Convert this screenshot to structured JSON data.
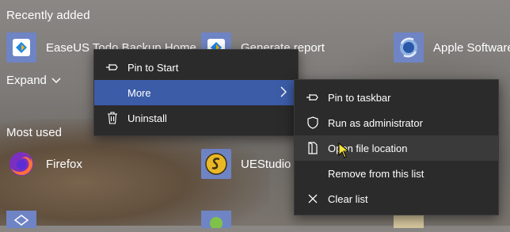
{
  "sections": {
    "recently_added": "Recently added",
    "expand": "Expand",
    "most_used": "Most used"
  },
  "recent_apps": [
    {
      "label": "EaseUS Todo Backup Home",
      "icon": "easeus-icon"
    },
    {
      "label": "Generate report",
      "icon": "report-icon"
    },
    {
      "label": "Apple Software",
      "icon": "apple-software-icon"
    }
  ],
  "most_used_apps": [
    {
      "label": "Firefox",
      "icon": "firefox-icon"
    },
    {
      "label": "UEStudio",
      "icon": "uestudio-icon"
    }
  ],
  "context_menu": {
    "items": [
      {
        "label": "Pin to Start",
        "icon": "pin-icon"
      },
      {
        "label": "More",
        "icon": "",
        "active": true
      },
      {
        "label": "Uninstall",
        "icon": "trash-icon"
      }
    ]
  },
  "submenu": {
    "items": [
      {
        "label": "Pin to taskbar",
        "icon": "pin-icon"
      },
      {
        "label": "Run as administrator",
        "icon": "shield-icon"
      },
      {
        "label": "Open file location",
        "icon": "folder-icon",
        "hover": true
      },
      {
        "label": "Remove from this list",
        "icon": ""
      },
      {
        "label": "Clear list",
        "icon": "close-icon"
      }
    ]
  },
  "colors": {
    "menu_bg": "#2b2b2b",
    "active": "#3c5ca8",
    "hover": "#3a3a3a",
    "tile_blue": "#6f84c4"
  }
}
